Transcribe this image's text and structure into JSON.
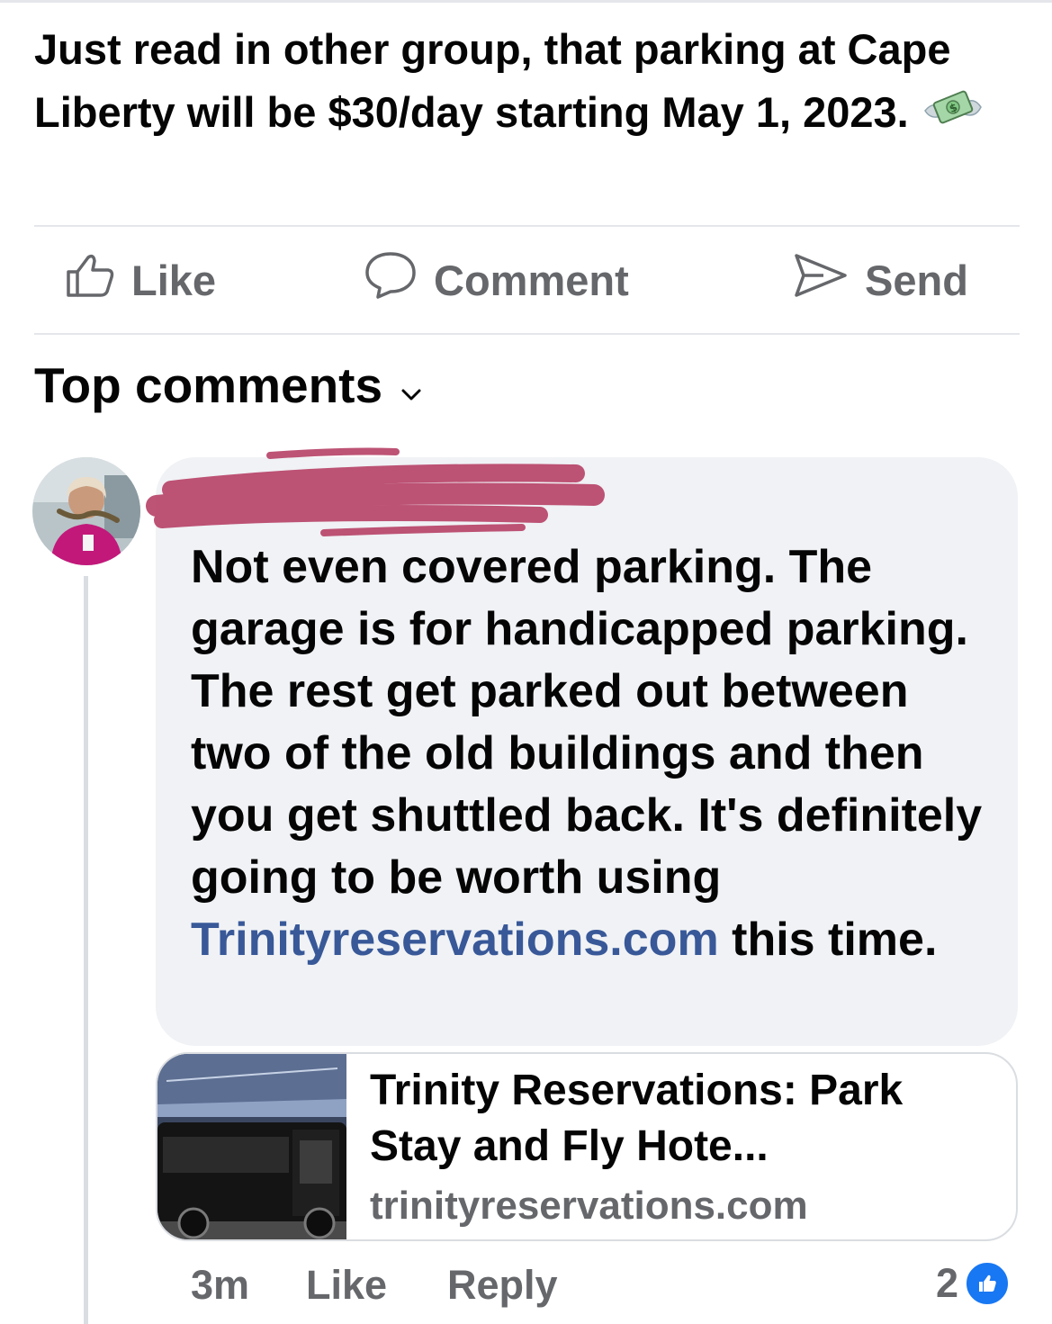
{
  "post": {
    "text": "Just read in other group, that parking at Cape Liberty will be $30/day starting May 1, 2023."
  },
  "actions": {
    "like_label": "Like",
    "comment_label": "Comment",
    "send_label": "Send"
  },
  "comments_header": {
    "label": "Top comments"
  },
  "comment": {
    "text_before_link": "Not even covered parking.  The garage is for handicapped parking.  The rest get parked out between two of the old buildings and then you get shuttled back. It's definitely going to be worth using ",
    "link_text": "Trinityreservations.com",
    "text_after_link": " this time.",
    "time": "3m",
    "like_label": "Like",
    "reply_label": "Reply",
    "reaction_count": "2"
  },
  "link_preview": {
    "title": "Trinity Reservations: Park Stay and Fly Hote...",
    "domain": "trinityreservations.com"
  },
  "colors": {
    "link": "#385898",
    "muted": "#65676b",
    "bubble": "#f0f2f5",
    "redaction": "#b8456a",
    "reaction": "#1877f2"
  },
  "icons": [
    "money-with-wings-icon",
    "thumbs-up-icon",
    "comment-icon",
    "send-icon",
    "chevron-down-icon",
    "like-reaction-icon"
  ]
}
